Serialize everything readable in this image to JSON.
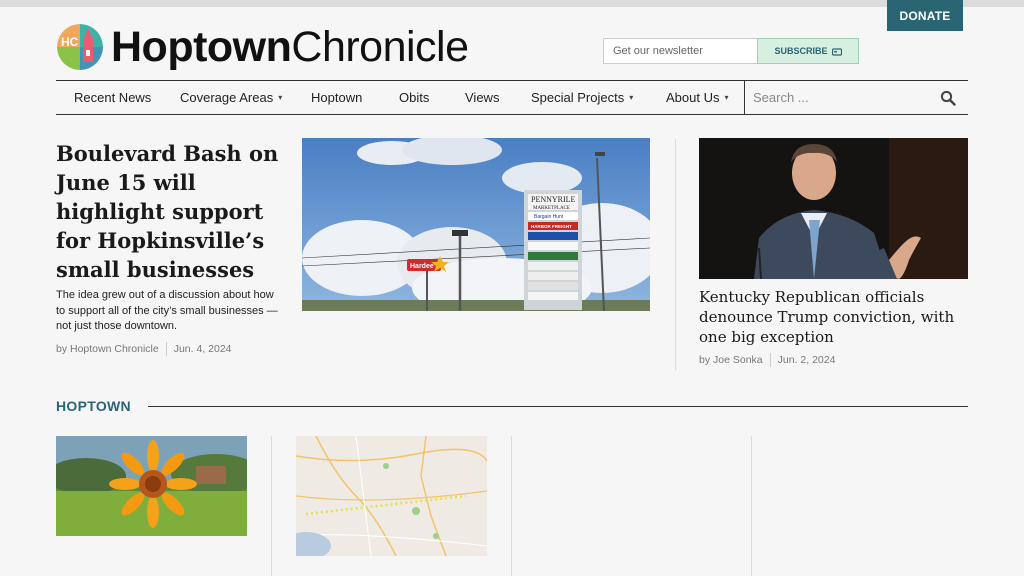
{
  "header": {
    "donate_label": "DONATE",
    "logo": {
      "mark_text": "HC",
      "name_bold": "Hoptown",
      "name_light": "Chronicle"
    },
    "newsletter": {
      "placeholder": "Get our newsletter",
      "button_label": "SUBSCRIBE"
    }
  },
  "nav": {
    "items": [
      {
        "label": "Recent News",
        "dropdown": false
      },
      {
        "label": "Coverage Areas",
        "dropdown": true
      },
      {
        "label": "Hoptown",
        "dropdown": false
      },
      {
        "label": "Obits",
        "dropdown": false
      },
      {
        "label": "Views",
        "dropdown": false
      },
      {
        "label": "Special Projects",
        "dropdown": true
      },
      {
        "label": "About Us",
        "dropdown": true
      }
    ],
    "search_placeholder": "Search ..."
  },
  "lead_story": {
    "title": "Boulevard Bash on June 15 will highlight support for Hopkinsville’s small businesses",
    "dek": "The idea grew out of a discussion about how to support all of the city’s small businesses — not just those downtown.",
    "byline": "by Hoptown Chronicle",
    "date": "Jun. 4, 2024",
    "photo_signs": [
      "PENNYRILE",
      "MARKETPLACE",
      "Bargain Hunt",
      "HARBOR FREIGHT",
      "Hardee's"
    ]
  },
  "side_story": {
    "title": "Kentucky Republican officials denounce Trump conviction, with one big exception",
    "byline": "by Joe Sonka",
    "date": "Jun. 2, 2024"
  },
  "section": {
    "label": "HOPTOWN"
  },
  "colors": {
    "accent": "#2a6574",
    "subscribe_bg": "#d6efe1",
    "text": "#222222"
  }
}
